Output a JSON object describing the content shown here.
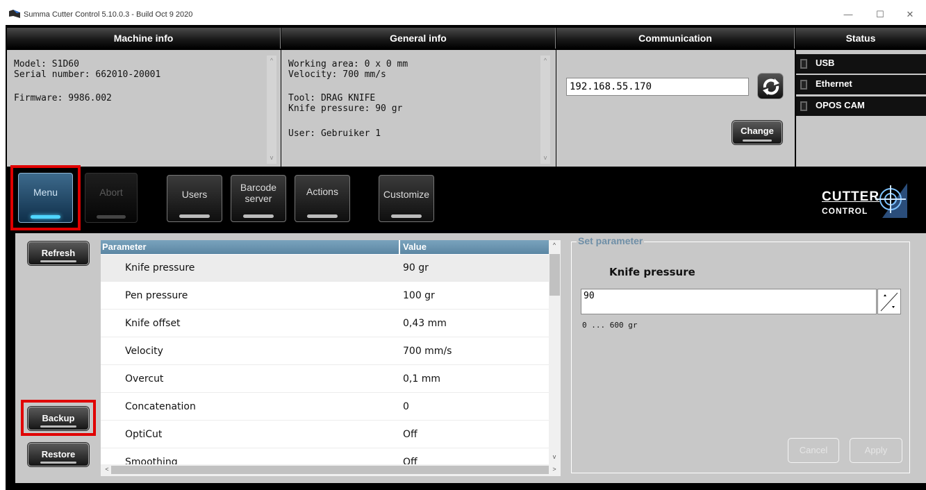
{
  "window": {
    "title": "Summa Cutter Control 5.10.0.3 - Build Oct  9 2020",
    "controls": {
      "minimize": "—",
      "maximize": "☐",
      "close": "✕"
    }
  },
  "columns": {
    "machine_info": "Machine info",
    "general_info": "General info",
    "communication": "Communication",
    "status": "Status"
  },
  "machine_info": {
    "model": "Model: S1D60",
    "serial": "Serial number: 662010-20001",
    "firmware": "Firmware: 9986.002"
  },
  "general_info": {
    "working_area": "Working area: 0 x 0 mm",
    "velocity": "Velocity: 700 mm/s",
    "tool": "Tool: DRAG KNIFE",
    "knife_pressure": "Knife pressure: 90 gr",
    "user": "User: Gebruiker 1"
  },
  "communication": {
    "ip_value": "192.168.55.170",
    "change_label": "Change"
  },
  "status": {
    "items": [
      {
        "label": "USB"
      },
      {
        "label": "Ethernet"
      },
      {
        "label": "OPOS CAM"
      }
    ]
  },
  "toolbar": {
    "menu": "Menu",
    "abort": "Abort",
    "users": "Users",
    "barcode_line1": "Barcode",
    "barcode_line2": "server",
    "actions": "Actions",
    "customize": "Customize"
  },
  "logo": {
    "line1": "CUTTER",
    "line2": "CONTROL"
  },
  "side_buttons": {
    "refresh": "Refresh",
    "backup": "Backup",
    "restore": "Restore"
  },
  "table": {
    "headers": {
      "parameter": "Parameter",
      "value": "Value"
    },
    "rows": [
      {
        "parameter": "Knife pressure",
        "value": "90 gr"
      },
      {
        "parameter": "Pen pressure",
        "value": "100 gr"
      },
      {
        "parameter": "Knife offset",
        "value": "0,43 mm"
      },
      {
        "parameter": "Velocity",
        "value": "700 mm/s"
      },
      {
        "parameter": "Overcut",
        "value": "0,1 mm"
      },
      {
        "parameter": "Concatenation",
        "value": "0"
      },
      {
        "parameter": "OptiCut",
        "value": "Off"
      },
      {
        "parameter": "Smoothing",
        "value": "Off"
      }
    ]
  },
  "set_parameter": {
    "legend": "Set parameter",
    "name": "Knife pressure",
    "value": "90",
    "range": "0 ... 600 gr",
    "cancel": "Cancel",
    "apply": "Apply"
  },
  "colors": {
    "highlight": "#e00000",
    "table_header": "#5b86a3",
    "panel_bg": "#c8c8c8"
  }
}
